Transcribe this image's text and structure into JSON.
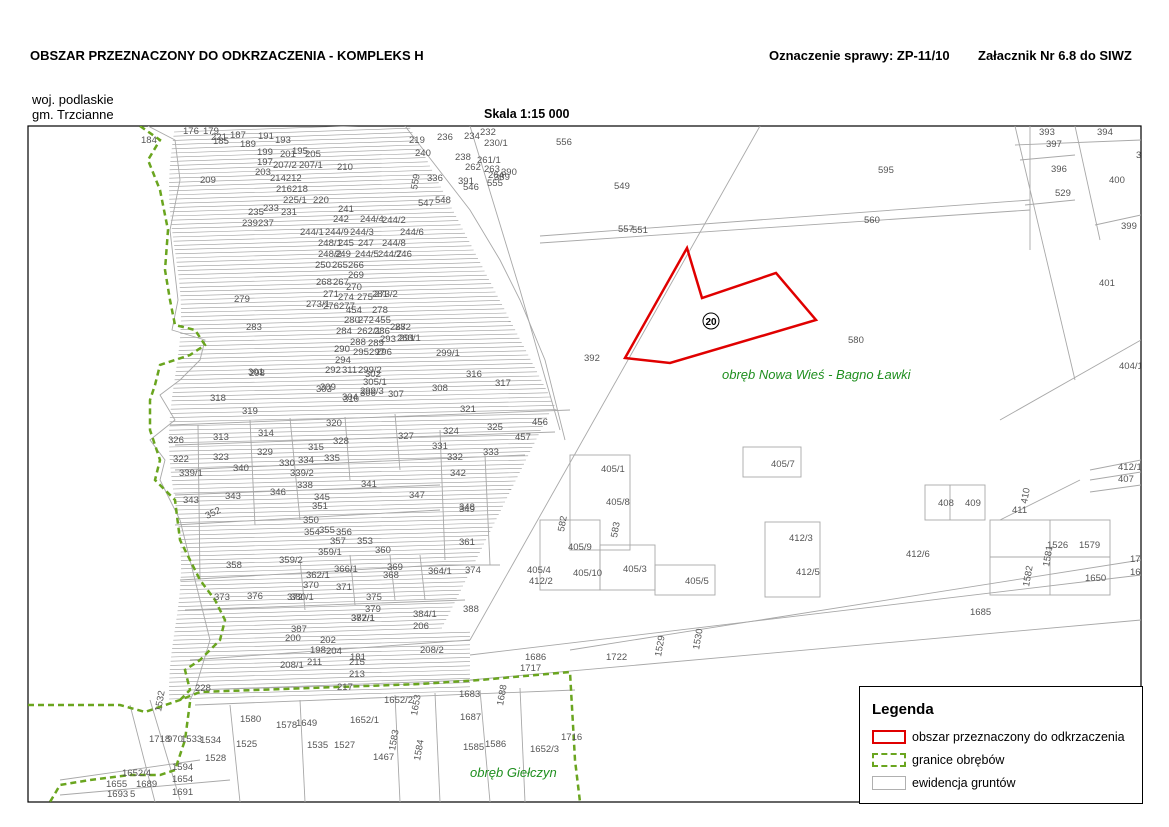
{
  "header": {
    "title": "OBSZAR PRZEZNACZONY DO ODKRZACZENIA - KOMPLEKS H",
    "case_ref": "Oznaczenie sprawy: ZP-11/10",
    "attachment": "Załacznik Nr 6.8 do SIWZ"
  },
  "location": {
    "voivodeship": "woj. podlaskie",
    "commune": "gm. Trzcianne"
  },
  "scale": "Skala  1:15 000",
  "map": {
    "area_marker": "20",
    "regions": [
      "obręb Nowa Wieś - Bagno Ławki",
      "obręb Giełczyn"
    ],
    "parcels": [
      "176",
      "179",
      "184",
      "185",
      "187",
      "189",
      "191",
      "193",
      "199",
      "201",
      "195",
      "205",
      "197",
      "207/2",
      "207/1",
      "203",
      "214212",
      "210",
      "209",
      "216",
      "218",
      "225/1",
      "220",
      "235",
      "233",
      "231",
      "239",
      "237",
      "241",
      "242",
      "244/4",
      "244/1",
      "244/9",
      "244/3",
      "244/2",
      "244/6",
      "248/1",
      "245",
      "247",
      "244/8",
      "248/2",
      "249",
      "244/5",
      "244/7",
      "246",
      "250",
      "265",
      "266",
      "269",
      "268",
      "267",
      "270",
      "271",
      "274",
      "275",
      "273/2",
      "273/1",
      "276",
      "277",
      "281",
      "454",
      "278",
      "279",
      "280",
      "272",
      "455",
      "282",
      "283",
      "284",
      "262/1",
      "286",
      "287",
      "263/1",
      "290",
      "288",
      "289",
      "293",
      "291",
      "294",
      "295",
      "297",
      "296",
      "292",
      "311",
      "299/2",
      "302",
      "298",
      "303",
      "304",
      "299/3",
      "305/1",
      "299/1",
      "301",
      "309",
      "310",
      "306",
      "307",
      "308",
      "316",
      "317",
      "318",
      "319",
      "320",
      "321",
      "326",
      "313",
      "314",
      "315",
      "328",
      "327",
      "324",
      "325",
      "456",
      "457",
      "322",
      "323",
      "329",
      "330",
      "334",
      "335",
      "331",
      "332",
      "333",
      "339/1",
      "340",
      "339/2",
      "338",
      "341",
      "342",
      "343",
      "343",
      "346",
      "345",
      "347",
      "348",
      "351",
      "352",
      "349",
      "350",
      "354",
      "355",
      "356",
      "357",
      "353",
      "359/1",
      "360",
      "361",
      "358",
      "359/2",
      "362/1",
      "366/1",
      "368",
      "364/1",
      "370",
      "371",
      "369",
      "373",
      "372",
      "375",
      "374",
      "376",
      "380/1",
      "379",
      "377/1",
      "382/1",
      "384/1",
      "388",
      "387",
      "206",
      "200",
      "202",
      "198",
      "204",
      "181",
      "208/2",
      "208/1",
      "211",
      "215",
      "213",
      "217",
      "228",
      "221",
      "219",
      "236",
      "234",
      "232",
      "230/1",
      "240",
      "238",
      "261/1",
      "262",
      "263",
      "264",
      "389",
      "390",
      "391",
      "336",
      "546",
      "555",
      "559",
      "547",
      "548",
      "556",
      "549",
      "595",
      "560",
      "557",
      "551",
      "580",
      "392",
      "393",
      "394",
      "395",
      "397",
      "396",
      "400",
      "529",
      "402",
      "398",
      "399",
      "401",
      "404/1",
      "405/1",
      "405/7",
      "405/8",
      "582",
      "583",
      "405/9",
      "405/10",
      "405/3",
      "405/5",
      "405/4",
      "412/2",
      "412/3",
      "412/5",
      "412/6",
      "412/1",
      "407",
      "408",
      "409",
      "410",
      "411",
      "1526",
      "1579",
      "1581",
      "1582",
      "1650",
      "1723",
      "1684",
      "1685",
      "1686",
      "1717",
      "1722",
      "1529",
      "1530",
      "1531",
      "1532",
      "1580",
      "1578",
      "1649",
      "1652/1",
      "1652/2",
      "1653",
      "1683",
      "1687",
      "1688",
      "1716",
      "1718",
      "970",
      "1533",
      "1534",
      "1525",
      "1528",
      "1535",
      "1527",
      "1467",
      "1583",
      "1584",
      "1585",
      "1586",
      "1652/3",
      "1652/4",
      "1594",
      "1654",
      "1655",
      "1689",
      "1691",
      "1693",
      "5"
    ]
  },
  "legend": {
    "title": "Legenda",
    "items": [
      {
        "label": "obszar przeznaczony do odkrzaczenia",
        "color": "#e00000"
      },
      {
        "label": "granice obrębów",
        "color": "#6aa51f"
      },
      {
        "label": "ewidencja gruntów",
        "color": "#b0b0b0"
      }
    ]
  }
}
